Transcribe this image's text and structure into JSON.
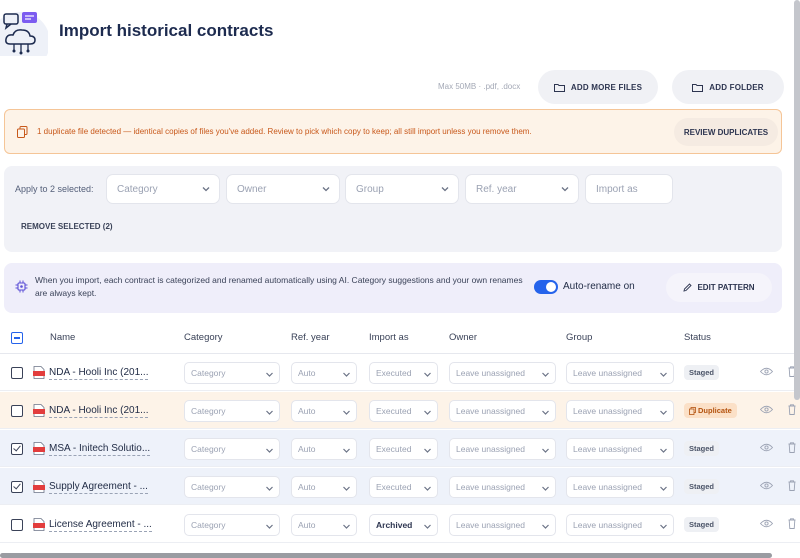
{
  "header": {
    "title": "Import historical contracts"
  },
  "file_bar": {
    "limit_text": "Max 50MB · .pdf, .docx",
    "add_files_label": "ADD MORE FILES",
    "add_folder_label": "ADD FOLDER"
  },
  "duplicate_banner": {
    "message": "1 duplicate file detected — identical copies of files you've added. Review to pick which copy to keep; all still import unless you remove them.",
    "review_label": "REVIEW DUPLICATES"
  },
  "bulk": {
    "label": "Apply to 2 selected:",
    "selects": [
      "Category",
      "Owner",
      "Group",
      "Ref. year",
      "Import as"
    ],
    "remove_label": "REMOVE SELECTED (2)"
  },
  "ai": {
    "text": "When you import, each contract is categorized and renamed automatically using AI. Category suggestions and your own renames are always kept.",
    "toggle_label": "Auto-rename on",
    "toggle_on": true,
    "edit_label": "EDIT PATTERN"
  },
  "table": {
    "headers": {
      "name": "Name",
      "category": "Category",
      "ref_year": "Ref. year",
      "import_as": "Import as",
      "owner": "Owner",
      "group": "Group",
      "status": "Status"
    },
    "rows": [
      {
        "name": "NDA - Hooli Inc (201...",
        "category": "Category",
        "ref_year": "Auto",
        "import_as": "Executed",
        "owner": "Leave unassigned",
        "group": "Leave unassigned",
        "status": "Staged",
        "checked": false
      },
      {
        "name": "NDA - Hooli Inc (201...",
        "category": "Category",
        "ref_year": "Auto",
        "import_as": "Executed",
        "owner": "Leave unassigned",
        "group": "Leave unassigned",
        "status": "Duplicate",
        "checked": false
      },
      {
        "name": "MSA - Initech Solutio...",
        "category": "Category",
        "ref_year": "Auto",
        "import_as": "Executed",
        "owner": "Leave unassigned",
        "group": "Leave unassigned",
        "status": "Staged",
        "checked": true
      },
      {
        "name": "Supply Agreement - ...",
        "category": "Category",
        "ref_year": "Auto",
        "import_as": "Executed",
        "owner": "Leave unassigned",
        "group": "Leave unassigned",
        "status": "Staged",
        "checked": true
      },
      {
        "name": "License Agreement - ...",
        "category": "Category",
        "ref_year": "Auto",
        "import_as": "Archived",
        "owner": "Leave unassigned",
        "group": "Leave unassigned",
        "status": "Staged",
        "checked": false
      }
    ]
  },
  "colors": {
    "accent": "#2563eb",
    "warning": "#c8581a",
    "warning_bg": "#fdf3e8",
    "selected_row_bg": "#eef2fa"
  }
}
